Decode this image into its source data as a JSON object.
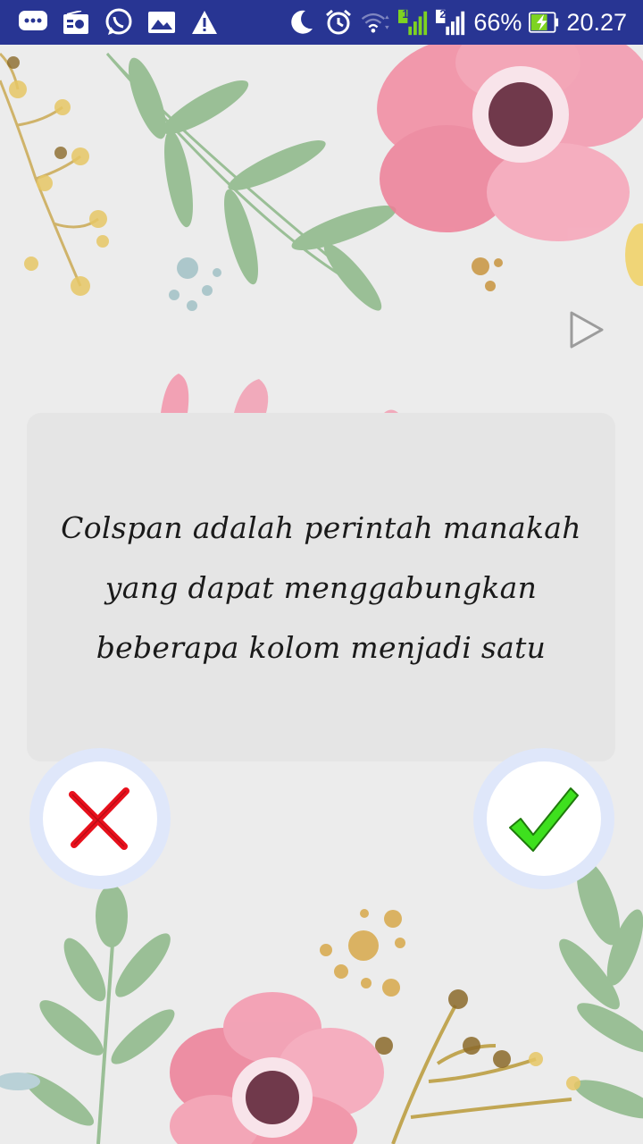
{
  "status_bar": {
    "battery_percent": "66%",
    "time": "20.27",
    "sim1_label": "1",
    "sim2_label": "2",
    "icons": [
      "chat-bubble-icon",
      "radio-icon",
      "whatsapp-icon",
      "gallery-icon",
      "warning-icon",
      "moon-icon",
      "alarm-icon",
      "wifi-icon",
      "signal-sim1-icon",
      "signal-sim2-icon",
      "battery-charging-icon"
    ]
  },
  "question": {
    "text": "Colspan adalah perintah manakah yang dapat menggabungkan beberapa kolom menjadi satu"
  },
  "buttons": {
    "false_icon": "cross-icon",
    "true_icon": "checkmark-icon",
    "next_icon": "play-arrow-icon"
  },
  "colors": {
    "status_bar": "#283593",
    "card": "#e5e5e5",
    "button_ring": "#dfe7fa",
    "cross": "#e8101c",
    "check": "#3ee01e"
  }
}
